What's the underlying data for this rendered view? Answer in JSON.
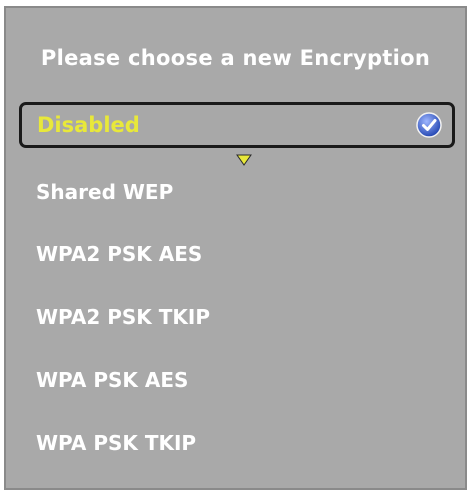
{
  "dialog": {
    "title": "Please choose a new Encryption",
    "selected_label": "Disabled",
    "options": [
      "Shared WEP",
      "WPA2 PSK AES",
      "WPA2 PSK TKIP",
      "WPA PSK AES",
      "WPA PSK TKIP"
    ]
  },
  "colors": {
    "panel_background": "#a9a9a9",
    "selected_text": "#e8e83a",
    "option_text": "#ffffff",
    "check_icon": "#3a5bc7"
  },
  "icons": {
    "selected_check": "checkmark-icon",
    "selection_pointer": "triangle-down-icon"
  }
}
